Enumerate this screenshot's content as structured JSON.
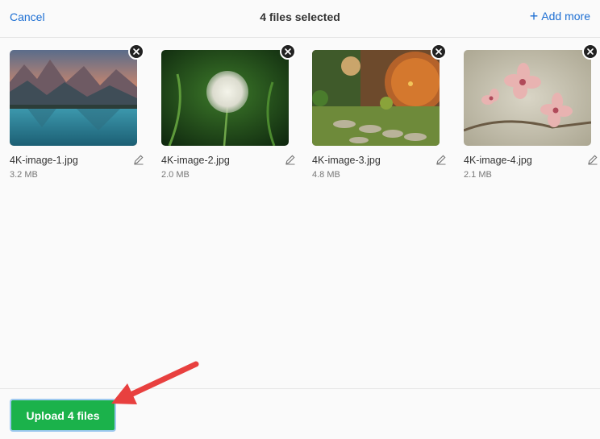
{
  "header": {
    "cancel_label": "Cancel",
    "title": "4 files selected",
    "add_more_label": "Add more"
  },
  "files": [
    {
      "name": "4K-image-1.jpg",
      "size": "3.2 MB",
      "thumbnail": "mountain-lake-icon"
    },
    {
      "name": "4K-image-2.jpg",
      "size": "2.0 MB",
      "thumbnail": "dandelion-icon"
    },
    {
      "name": "4K-image-3.jpg",
      "size": "4.8 MB",
      "thumbnail": "round-door-house-icon"
    },
    {
      "name": "4K-image-4.jpg",
      "size": "2.1 MB",
      "thumbnail": "blossom-flowers-icon"
    }
  ],
  "footer": {
    "upload_label": "Upload 4 files"
  },
  "colors": {
    "link": "#1d6fd3",
    "upload_button": "#1bb24b",
    "annotation_arrow": "#e8403f"
  },
  "icons": {
    "remove": "close-icon",
    "edit": "pencil-icon",
    "add": "plus-icon"
  }
}
